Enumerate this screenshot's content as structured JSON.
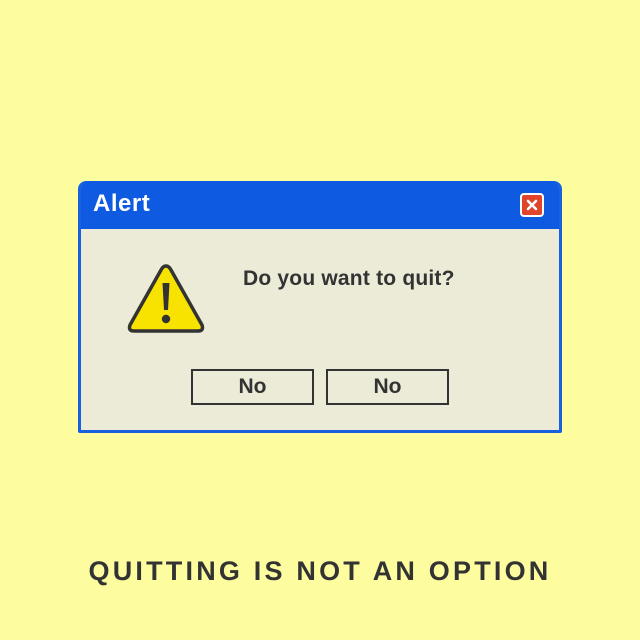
{
  "dialog": {
    "title": "Alert",
    "close_icon": "close-x-icon",
    "warning_icon": "warning-triangle-icon",
    "message": "Do you want to quit?",
    "buttons": [
      {
        "label": "No"
      },
      {
        "label": "No"
      }
    ]
  },
  "tagline": "QUITTING IS NOT AN OPTION",
  "colors": {
    "background": "#fdfd9f",
    "titlebar": "#0e5ae0",
    "dialog_body": "#ecebd7",
    "close_button": "#e0452c",
    "warning_yellow": "#f7e200",
    "text": "#333333"
  }
}
